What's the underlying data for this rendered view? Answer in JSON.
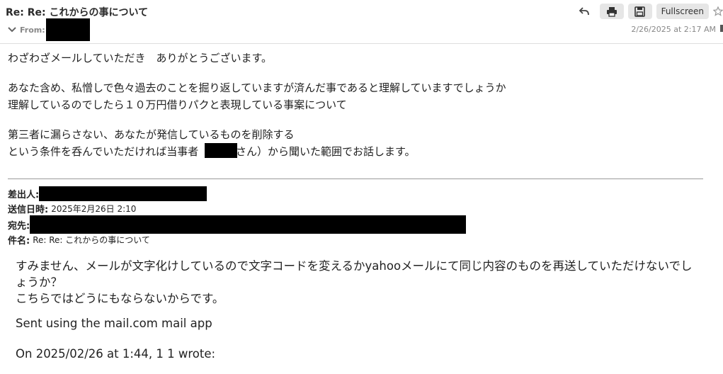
{
  "header": {
    "subject": "Re: Re: これからの事について",
    "from_label": "From:",
    "date": "2/26/2025 at 2:17 AM",
    "fullscreen_label": "Fullscreen"
  },
  "icons": {
    "reply": "reply-icon",
    "print": "print-icon",
    "save": "save-icon",
    "star": "star-icon",
    "chevron": "chevron-down-icon"
  },
  "message": {
    "line1": "わざわざメールしていただき　ありがとうございます。",
    "line2": "あなた含め、私憎しで色々過去のことを掘り返していますが済んだ事であると理解していますでしょうか",
    "line3": "理解しているのでしたら１０万円借りパクと表現している事案について",
    "line4": "第三者に漏らさない、あなたが発信しているものを削除する",
    "line5_pre": "という条件を呑んでいただければ当事者",
    "line5_post": "さん）から聞いた範囲でお話します。"
  },
  "forward_meta": {
    "sender_label": "差出人:",
    "sent_label": "送信日時:",
    "sent_value": "2025年2月26日 2:10",
    "to_label": "宛先:",
    "subject_label": "件名:",
    "subject_value": "Re: Re: これからの事について"
  },
  "quoted": {
    "line1": "すみません、メールが文字化けしているので文字コードを変えるかyahooメールにて同じ内容のものを再送していただけないでし",
    "line2": "ょうか？",
    "line3": "こちらではどうにもならないからです。",
    "line4": "Sent using the mail.com mail app",
    "line5": "On 2025/02/26 at 1:44, 1 1 wrote:"
  }
}
